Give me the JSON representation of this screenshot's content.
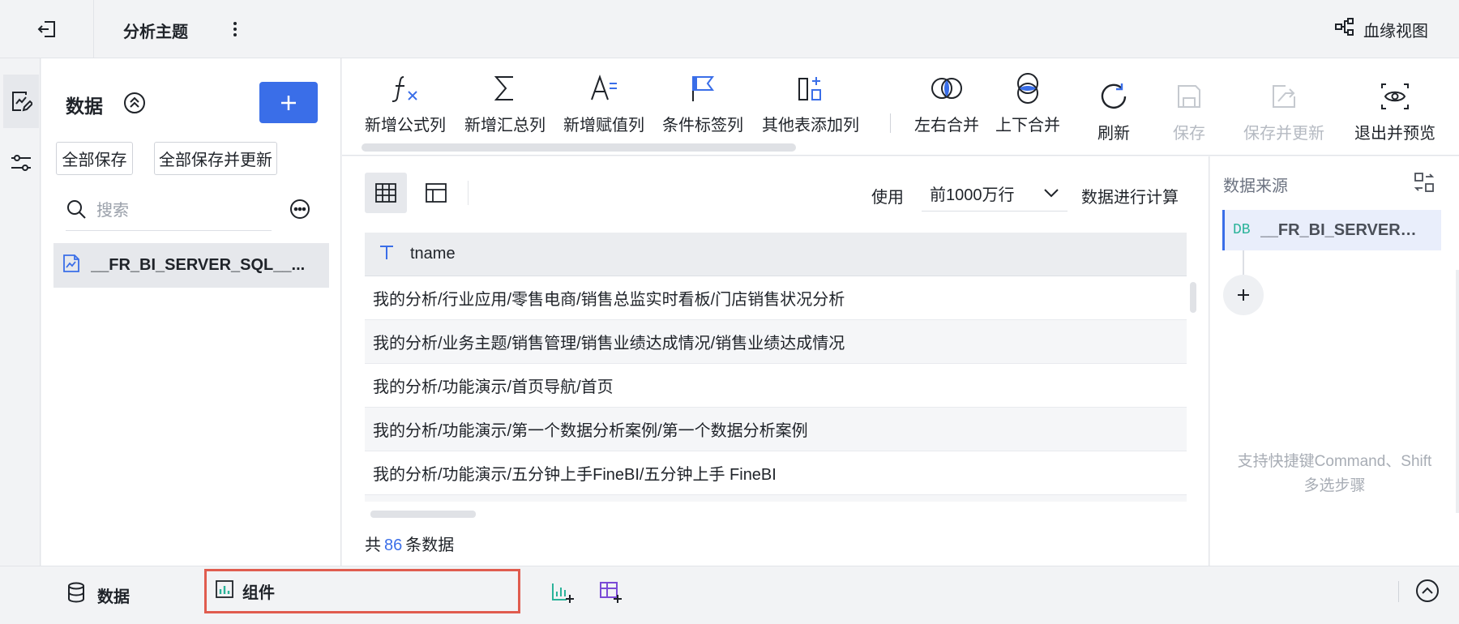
{
  "header": {
    "title": "分析主题",
    "lineage_label": "血缘视图"
  },
  "rail": {
    "items": [
      {
        "icon": "data-edit-icon",
        "active": true
      },
      {
        "icon": "settings-sliders-icon",
        "active": false
      }
    ]
  },
  "left_panel": {
    "title": "数据",
    "add_label": "+",
    "save_all_label": "全部保存",
    "save_all_update_label": "全部保存并更新",
    "search_placeholder": "搜索",
    "items": [
      {
        "name": "__FR_BI_SERVER_SQL__..."
      }
    ]
  },
  "toolbar": {
    "items": [
      {
        "label": "新增公式列",
        "icon": "formula-icon"
      },
      {
        "label": "新增汇总列",
        "icon": "sigma-icon"
      },
      {
        "label": "新增赋值列",
        "icon": "assign-icon"
      },
      {
        "label": "条件标签列",
        "icon": "flag-icon"
      },
      {
        "label": "其他表添加列",
        "icon": "add-column-icon"
      },
      {
        "label": "左右合并",
        "icon": "horizontal-merge-icon"
      },
      {
        "label": "上下合并",
        "icon": "vertical-merge-icon"
      },
      {
        "label": "刷新",
        "icon": "refresh-icon"
      },
      {
        "label": "保存",
        "icon": "save-icon",
        "disabled": true
      },
      {
        "label": "保存并更新",
        "icon": "save-update-icon",
        "disabled": true
      },
      {
        "label": "退出并预览",
        "icon": "eye-icon"
      }
    ]
  },
  "preview": {
    "use_label": "使用",
    "row_limit": "前1000万行",
    "calc_label": "数据进行计算",
    "column": {
      "type_icon": "T",
      "name": "tname"
    },
    "rows": [
      "我的分析/行业应用/零售电商/销售总监实时看板/门店销售状况分析",
      "我的分析/业务主题/销售管理/销售业绩达成情况/销售业绩达成情况",
      "我的分析/功能演示/首页导航/首页",
      "我的分析/功能演示/第一个数据分析案例/第一个数据分析案例",
      "我的分析/功能演示/五分钟上手FineBI/五分钟上手 FineBI"
    ],
    "count_prefix": "共",
    "count": "86",
    "count_suffix": "条数据"
  },
  "right_panel": {
    "title": "数据来源",
    "source_badge": "DB",
    "source_name": "__FR_BI_SERVER_S...",
    "add_label": "+",
    "hint_line1": "支持快捷键Command、Shift",
    "hint_line2": "多选步骤"
  },
  "bottom_bar": {
    "data_tab": "数据",
    "component_tab": "组件"
  },
  "colors": {
    "accent": "#3a6ee8",
    "highlight_border": "#e05c4f",
    "db_badge": "#2bb39a"
  }
}
